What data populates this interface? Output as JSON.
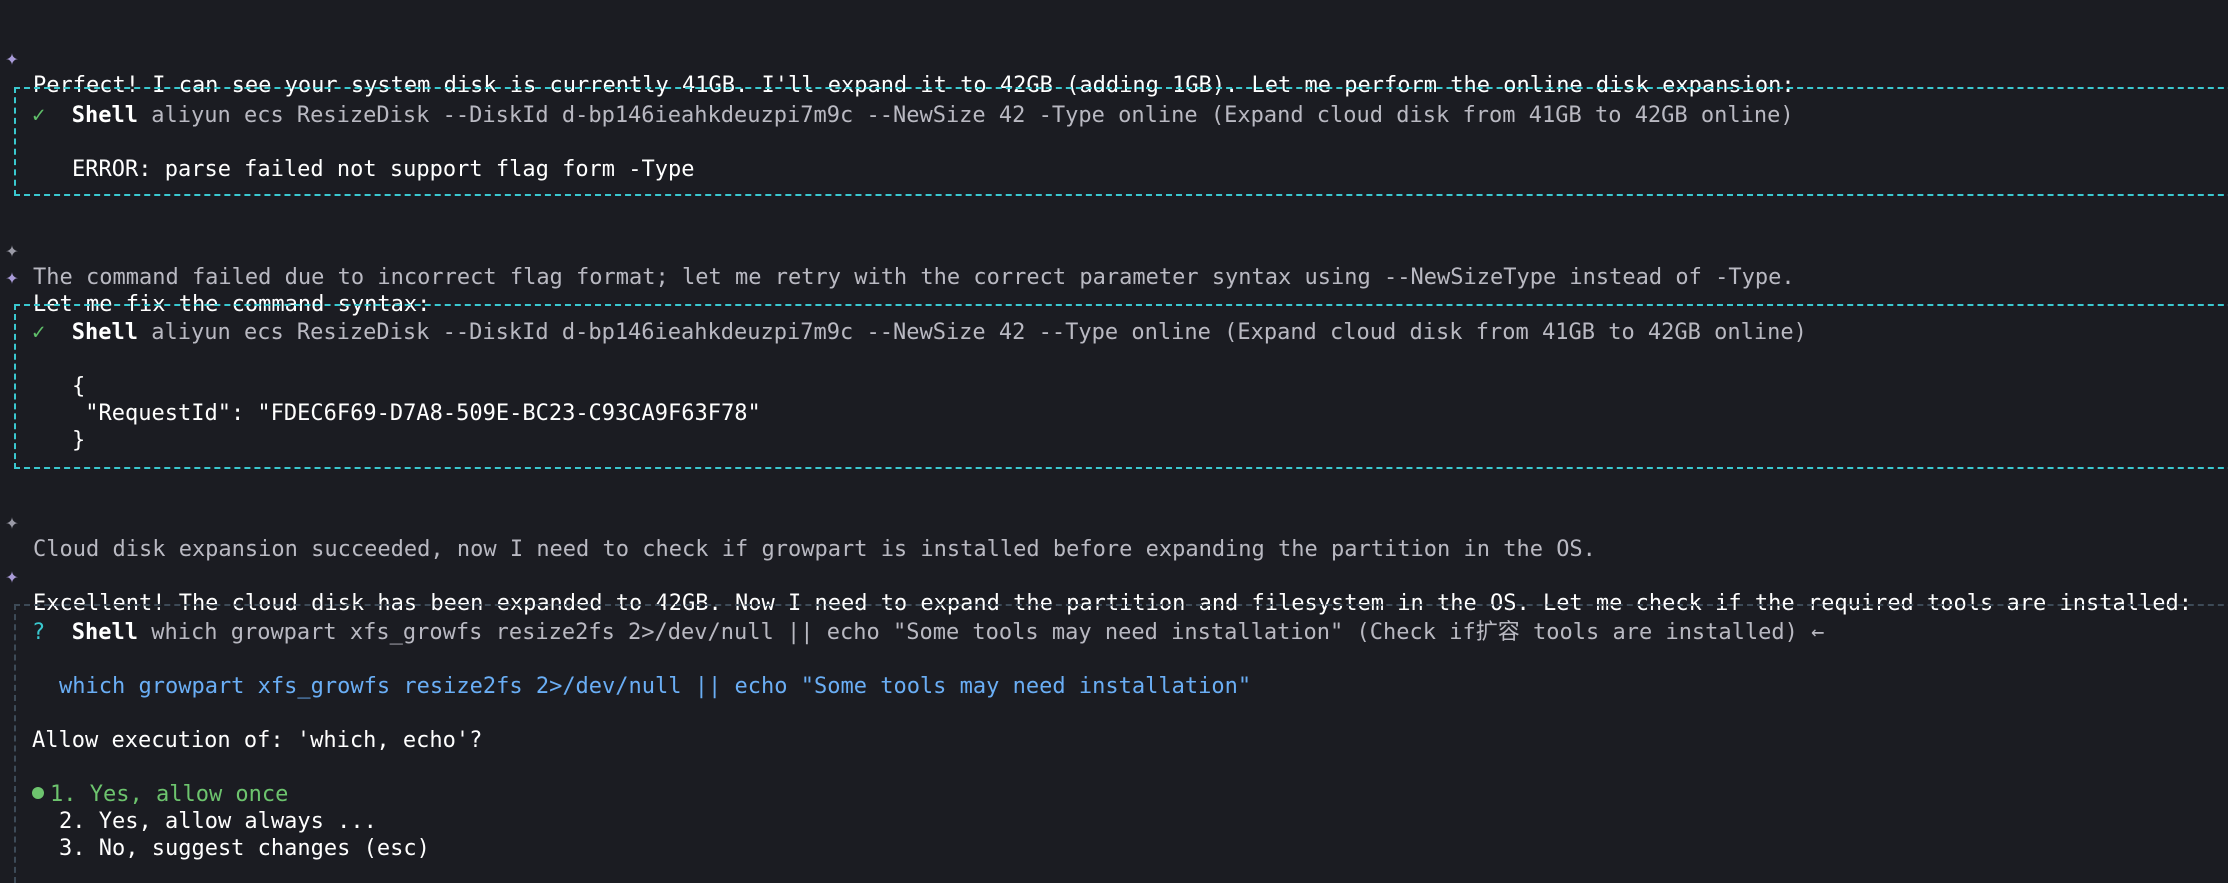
{
  "messages": {
    "m1": "Perfect! I can see your system disk is currently 41GB. I'll expand it to 42GB (adding 1GB). Let me perform the online disk expansion:",
    "m2": "The command failed due to incorrect flag format; let me retry with the correct parameter syntax using --NewSizeType instead of -Type.",
    "m3": "Let me fix the command syntax:",
    "m4": "Cloud disk expansion succeeded, now I need to check if growpart is installed before expanding the partition in the OS.",
    "m5": "Excellent! The cloud disk has been expanded to 42GB. Now I need to expand the partition and filesystem in the OS. Let me check if the required tools are installed:"
  },
  "icons": {
    "sparkle": "✦",
    "check": "✓",
    "question": "?",
    "return_arrow": "←"
  },
  "tool1": {
    "tool": "Shell",
    "command": "aliyun ecs ResizeDisk --DiskId d-bp146ieahkdeuzpi7m9c --NewSize 42 -Type online (Expand cloud disk from 41GB to 42GB online)",
    "output": "ERROR: parse failed not support flag form -Type"
  },
  "tool2": {
    "tool": "Shell",
    "command": "aliyun ecs ResizeDisk --DiskId d-bp146ieahkdeuzpi7m9c --NewSize 42 --Type online (Expand cloud disk from 41GB to 42GB online)",
    "output_lines": [
      "{",
      " \"RequestId\": \"FDEC6F69-D7A8-509E-BC23-C93CA9F63F78\"",
      "}"
    ]
  },
  "tool3": {
    "tool": "Shell",
    "command": "which growpart xfs_growfs resize2fs 2>/dev/null || echo \"Some tools may need installation\" (Check if扩容 tools are installed)",
    "preview": "which growpart xfs_growfs resize2fs 2>/dev/null || echo \"Some tools may need installation\"",
    "prompt": "Allow execution of: 'which, echo'?",
    "options": [
      "1. Yes, allow once",
      "2. Yes, allow always ...",
      "3. No, suggest changes (esc)"
    ]
  },
  "colors": {
    "background": "#1b1c22",
    "border_cyan": "#3ac8cf",
    "sparkle": "#a99bd8",
    "check_green": "#5fbf6a",
    "blue_cmd": "#6aaef5",
    "selected_green": "#6dc46e"
  }
}
